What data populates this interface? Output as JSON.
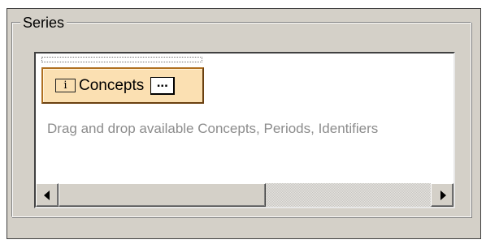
{
  "series_group": {
    "legend": "Series"
  },
  "concepts_item": {
    "icon": "info-icon",
    "icon_glyph": "i",
    "label": "Concepts",
    "ellipsis": "...",
    "background_color": "#fbe0b2"
  },
  "hint_text": "Drag and drop available Concepts, Periods, Identifiers",
  "scrollbar": {
    "left_arrow": "scroll-left-arrow-icon",
    "right_arrow": "scroll-right-arrow-icon"
  }
}
